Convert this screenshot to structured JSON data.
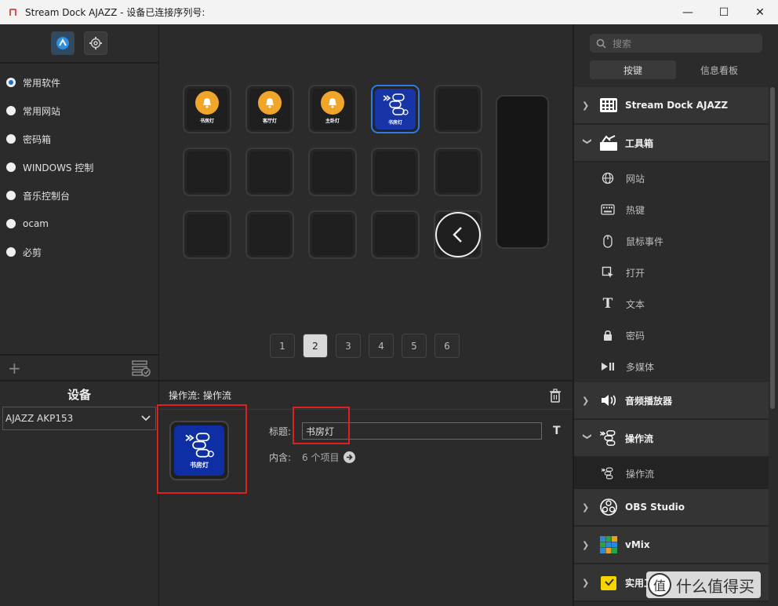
{
  "window": {
    "title": "Stream Dock AJAZZ - 设备已连接序列号:",
    "minimize": "—",
    "maximize": "☐",
    "close": "✕"
  },
  "profiles": {
    "items": [
      {
        "label": "常用软件",
        "checked": true
      },
      {
        "label": "常用网站",
        "checked": false
      },
      {
        "label": "密码箱",
        "checked": false
      },
      {
        "label": "WINDOWS 控制",
        "checked": false
      },
      {
        "label": "音乐控制台",
        "checked": false
      },
      {
        "label": "ocam",
        "checked": false
      },
      {
        "label": "必剪",
        "checked": false
      }
    ],
    "add": "+"
  },
  "device": {
    "title": "设备",
    "selected": "AJAZZ AKP153"
  },
  "keys": {
    "row1": [
      {
        "label": "书房灯",
        "type": "bell"
      },
      {
        "label": "客厅灯",
        "type": "bell"
      },
      {
        "label": "主卧灯",
        "type": "bell"
      },
      {
        "label": "书房灯",
        "type": "flow"
      }
    ]
  },
  "pager": {
    "pages": [
      "1",
      "2",
      "3",
      "4",
      "5",
      "6"
    ],
    "active": "2"
  },
  "editor": {
    "crumb": "操作流: 操作流",
    "preview_label": "书房灯",
    "title_label": "标题:",
    "title_value": "书房灯",
    "contains_label": "内含:",
    "contains_value": "6 个项目"
  },
  "right": {
    "search_placeholder": "搜索",
    "tabs": [
      "按键",
      "信息看板"
    ],
    "categories": {
      "stream_dock": "Stream Dock AJAZZ",
      "toolbox": "工具箱",
      "toolbox_items": [
        "网站",
        "热键",
        "鼠标事件",
        "打开",
        "文本",
        "密码",
        "多媒体"
      ],
      "audio": "音频播放器",
      "flow": "操作流",
      "flow_items": [
        "操作流"
      ],
      "obs": "OBS Studio",
      "vmix": "vMix",
      "utils": "实用工具"
    }
  },
  "watermark": {
    "logo": "值",
    "text": "什么值得买"
  }
}
